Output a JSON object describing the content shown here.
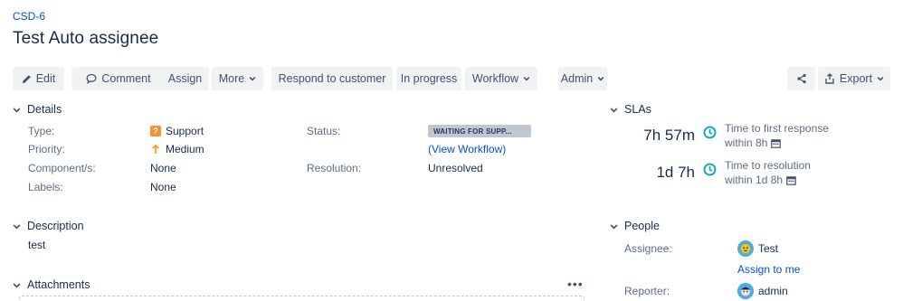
{
  "issue": {
    "key": "CSD-6",
    "title": "Test Auto assignee"
  },
  "toolbar": {
    "edit": "Edit",
    "comment": "Comment",
    "assign": "Assign",
    "more": "More",
    "respond": "Respond to customer",
    "in_progress": "In progress",
    "workflow": "Workflow",
    "admin": "Admin",
    "export": "Export"
  },
  "details": {
    "heading": "Details",
    "type_label": "Type:",
    "type_value": "Support",
    "priority_label": "Priority:",
    "priority_value": "Medium",
    "components_label": "Component/s:",
    "components_value": "None",
    "labels_label": "Labels:",
    "labels_value": "None",
    "status_label": "Status:",
    "status_value": "WAITING FOR SUPP...",
    "view_workflow": "(View Workflow)",
    "resolution_label": "Resolution:",
    "resolution_value": "Unresolved"
  },
  "description": {
    "heading": "Description",
    "text": "test"
  },
  "attachments": {
    "heading": "Attachments",
    "menu": "•••"
  },
  "slas": {
    "heading": "SLAs",
    "items": [
      {
        "time": "7h 57m",
        "name": "Time to first response",
        "goal": "within 8h"
      },
      {
        "time": "1d 7h",
        "name": "Time to resolution",
        "goal": "within 1d 8h"
      }
    ]
  },
  "people": {
    "heading": "People",
    "assignee_label": "Assignee:",
    "assignee_value": "Test",
    "assign_to_me": "Assign to me",
    "reporter_label": "Reporter:",
    "reporter_value": "admin"
  },
  "colors": {
    "link": "#0052cc",
    "button_bg": "#f1f2f4",
    "sla_clock": "#00a3bf",
    "type_icon": "#f79232",
    "priority_arrow": "#ff991f",
    "lozenge": "#c1c7d0"
  }
}
